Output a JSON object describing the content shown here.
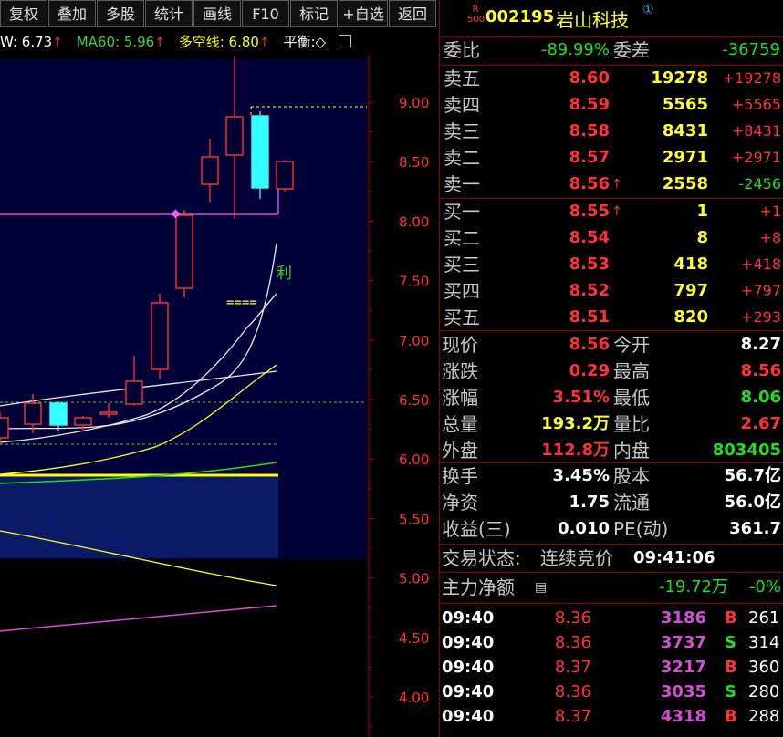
{
  "toolbar": {
    "buttons": [
      "复权",
      "叠加",
      "多股",
      "统计",
      "画线",
      "F10",
      "标记",
      "+自选",
      "返回"
    ]
  },
  "indicators": {
    "w_label": "W: 6.73",
    "ma60_label": "MA60: 5.96",
    "dkx_label": "多空线: 6.80",
    "pb_label": "平衡:◇",
    "up_arrow": "↑"
  },
  "chart": {
    "y_ticks": [
      "9.00",
      "8.50",
      "8.00",
      "7.50",
      "7.00",
      "6.50",
      "6.00",
      "5.50",
      "5.00",
      "4.50",
      "4.00"
    ],
    "li_text": "利",
    "eq_text": "===="
  },
  "stock": {
    "badge_top": "R",
    "badge_bottom": "500",
    "code": "002195",
    "name": "岩山科技",
    "info_glyph": "①"
  },
  "weibi": {
    "label": "委比",
    "value": "-89.99%",
    "diff_label": "委差",
    "diff_value": "-36759"
  },
  "asks": [
    {
      "label": "卖五",
      "price": "8.60",
      "volume": "19278",
      "change": "+19278",
      "arrow": ""
    },
    {
      "label": "卖四",
      "price": "8.59",
      "volume": "5565",
      "change": "+5565",
      "arrow": ""
    },
    {
      "label": "卖三",
      "price": "8.58",
      "volume": "8431",
      "change": "+8431",
      "arrow": ""
    },
    {
      "label": "卖二",
      "price": "8.57",
      "volume": "2971",
      "change": "+2971",
      "arrow": ""
    },
    {
      "label": "卖一",
      "price": "8.56",
      "volume": "2558",
      "change": "-2456",
      "arrow": "↑"
    }
  ],
  "bids": [
    {
      "label": "买一",
      "price": "8.55",
      "volume": "1",
      "change": "+1",
      "arrow": "↑"
    },
    {
      "label": "买二",
      "price": "8.54",
      "volume": "8",
      "change": "+8",
      "arrow": ""
    },
    {
      "label": "买三",
      "price": "8.53",
      "volume": "418",
      "change": "+418",
      "arrow": ""
    },
    {
      "label": "买四",
      "price": "8.52",
      "volume": "797",
      "change": "+797",
      "arrow": ""
    },
    {
      "label": "买五",
      "price": "8.51",
      "volume": "820",
      "change": "+293",
      "arrow": ""
    }
  ],
  "quote": {
    "rows": [
      {
        "l1": "现价",
        "v1": "8.56",
        "l2": "今开",
        "v2": "8.27"
      },
      {
        "l1": "涨跌",
        "v1": "0.29",
        "l2": "最高",
        "v2": "8.56"
      },
      {
        "l1": "涨幅",
        "v1": "3.51%",
        "l2": "最低",
        "v2": "8.06"
      },
      {
        "l1": "总量",
        "v1": "193.2万",
        "l2": "量比",
        "v2": "2.67"
      },
      {
        "l1": "外盘",
        "v1": "112.8万",
        "l2": "内盘",
        "v2": "803405"
      }
    ]
  },
  "fundamentals": {
    "rows": [
      {
        "l1": "换手",
        "v1": "3.45%",
        "l2": "股本",
        "v2": "56.7亿"
      },
      {
        "l1": "净资",
        "v1": "1.75",
        "l2": "流通",
        "v2": "56.0亿"
      },
      {
        "l1": "收益(三)",
        "v1": "0.010",
        "l2": "PE(动)",
        "v2": "361.7"
      }
    ]
  },
  "status": {
    "label": "交易状态:",
    "state": "连续竞价",
    "time": "09:41:06"
  },
  "mainforce": {
    "label": "主力净额",
    "value": "-19.72万",
    "pct": "-0%"
  },
  "ticks": [
    {
      "time": "09:40",
      "price": "8.36",
      "vol": "3186",
      "side": "B",
      "count": "261"
    },
    {
      "time": "09:40",
      "price": "8.36",
      "vol": "3737",
      "side": "S",
      "count": "314"
    },
    {
      "time": "09:40",
      "price": "8.37",
      "vol": "3217",
      "side": "B",
      "count": "360"
    },
    {
      "time": "09:40",
      "price": "8.36",
      "vol": "3035",
      "side": "S",
      "count": "280"
    },
    {
      "time": "09:40",
      "price": "8.37",
      "vol": "4318",
      "side": "B",
      "count": "288"
    }
  ]
}
